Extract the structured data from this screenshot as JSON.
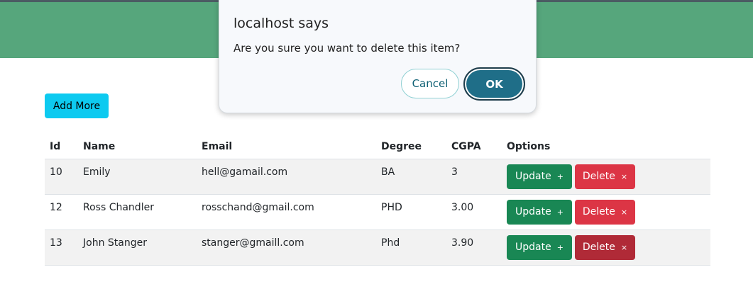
{
  "toolbar": {
    "add_more_label": "Add More"
  },
  "table": {
    "headers": [
      "Id",
      "Name",
      "Email",
      "Degree",
      "CGPA",
      "Options"
    ],
    "rows": [
      {
        "id": "10",
        "name": "Emily",
        "email": "hell@gamail.com",
        "degree": "BA",
        "cgpa": "3"
      },
      {
        "id": "12",
        "name": "Ross Chandler",
        "email": "rosschand@gmail.com",
        "degree": "PHD",
        "cgpa": "3.00"
      },
      {
        "id": "13",
        "name": "John Stanger",
        "email": "stanger@gmaill.com",
        "degree": "Phd",
        "cgpa": "3.90"
      }
    ],
    "update_label": "Update",
    "update_icon": "plus-icon",
    "delete_label": "Delete",
    "delete_icon": "close-icon"
  },
  "dialog": {
    "title": "localhost says",
    "message": "Are you sure you want to delete this item?",
    "cancel_label": "Cancel",
    "ok_label": "OK"
  },
  "colors": {
    "header_green": "#56a67c",
    "info": "#0dcaf0",
    "success": "#198754",
    "danger": "#dc3545",
    "dialog_primary": "#1f6e88"
  }
}
